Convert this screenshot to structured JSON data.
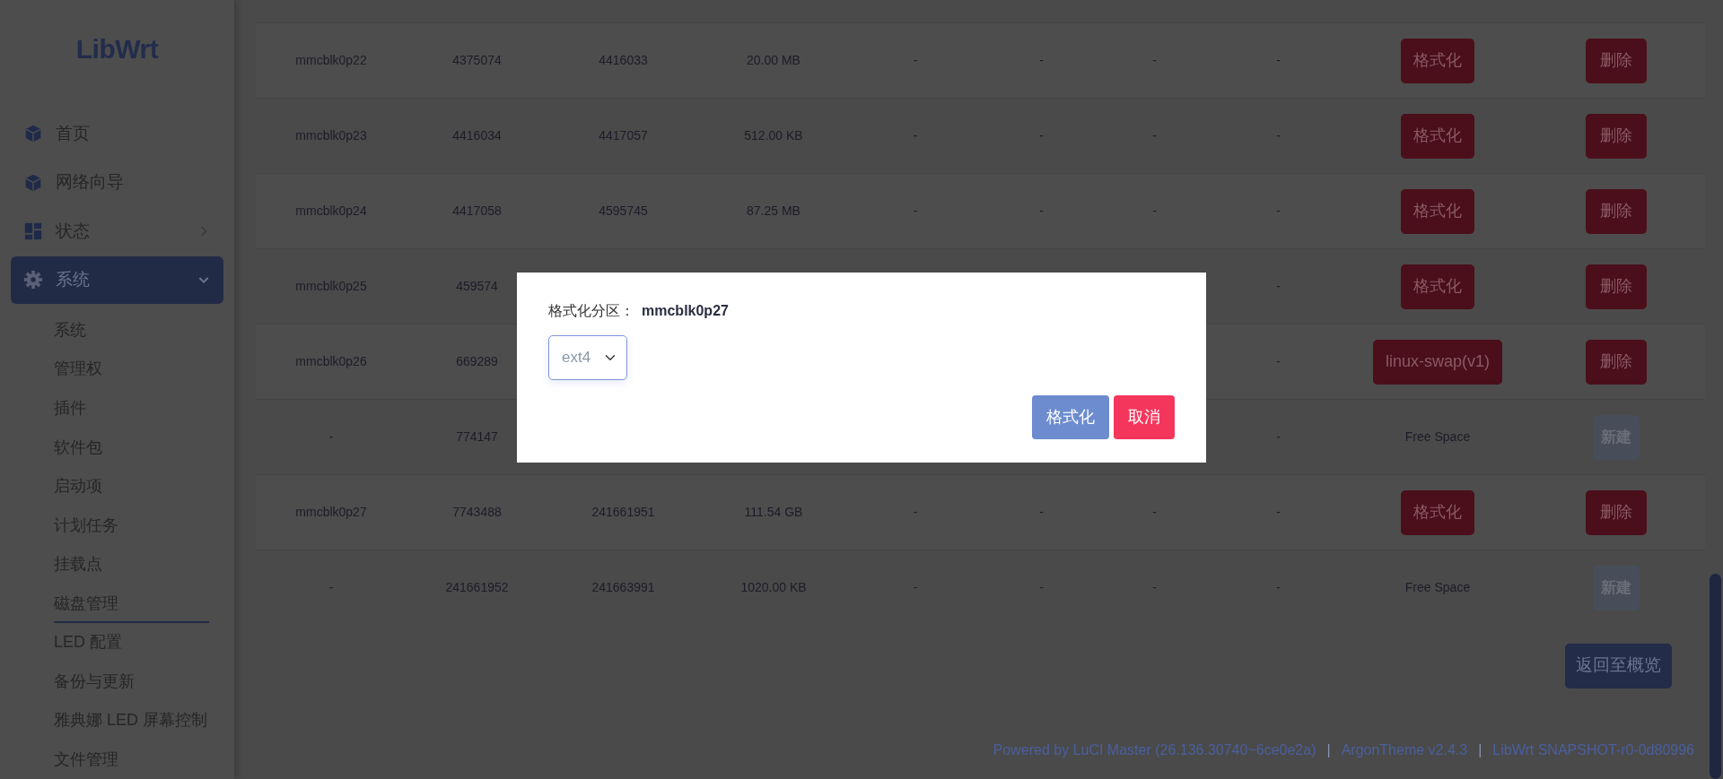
{
  "sidebar": {
    "logo": "LibWrt",
    "items": [
      {
        "label": "首页",
        "selected": false
      },
      {
        "label": "网络向导",
        "selected": false
      },
      {
        "label": "状态",
        "selected": false,
        "expanded": false
      },
      {
        "label": "系统",
        "selected": true,
        "expanded": true,
        "children": [
          {
            "label": "系统",
            "selected": false
          },
          {
            "label": "管理权",
            "selected": false
          },
          {
            "label": "插件",
            "selected": false
          },
          {
            "label": "软件包",
            "selected": false
          },
          {
            "label": "启动项",
            "selected": false
          },
          {
            "label": "计划任务",
            "selected": false
          },
          {
            "label": "挂载点",
            "selected": false
          },
          {
            "label": "磁盘管理",
            "selected": true
          },
          {
            "label": "LED 配置",
            "selected": false
          },
          {
            "label": "备份与更新",
            "selected": false
          },
          {
            "label": "雅典娜 LED 屏幕控制",
            "selected": false
          },
          {
            "label": "文件管理",
            "selected": false
          }
        ]
      }
    ]
  },
  "table": {
    "rows": [
      {
        "name": "mmcblk0p22",
        "start": "4375074",
        "end": "4416033",
        "size": "20.00 MB",
        "column_5": "-",
        "column_6": "-",
        "column_7": "-",
        "column_8": "-",
        "format": {
          "kind": "button",
          "label": "格式化"
        },
        "action": {
          "label": "删除",
          "disabled": false
        }
      },
      {
        "name": "mmcblk0p23",
        "start": "4416034",
        "end": "4417057",
        "size": "512.00 KB",
        "column_5": "-",
        "column_6": "-",
        "column_7": "-",
        "column_8": "-",
        "format": {
          "kind": "button",
          "label": "格式化"
        },
        "action": {
          "label": "删除",
          "disabled": false
        }
      },
      {
        "name": "mmcblk0p24",
        "start": "4417058",
        "end": "4595745",
        "size": "87.25 MB",
        "column_5": "-",
        "column_6": "-",
        "column_7": "-",
        "column_8": "-",
        "format": {
          "kind": "button",
          "label": "格式化"
        },
        "action": {
          "label": "删除",
          "disabled": false
        }
      },
      {
        "name": "mmcblk0p25",
        "start": "459574",
        "column_8": "-",
        "format": {
          "kind": "button",
          "label": "格式化"
        },
        "action": {
          "label": "删除",
          "disabled": false
        }
      },
      {
        "name": "mmcblk0p26",
        "start": "669289",
        "column_8": "-",
        "format": {
          "kind": "button",
          "label": "linux-swap(v1)"
        },
        "action": {
          "label": "删除",
          "disabled": false
        }
      },
      {
        "name": "-",
        "start": "774147",
        "column_8": "-",
        "format": {
          "kind": "text",
          "label": "Free Space"
        },
        "action": {
          "label": "新建",
          "disabled": true
        }
      },
      {
        "name": "mmcblk0p27",
        "start": "7743488",
        "end": "241661951",
        "size": "111.54 GB",
        "column_5": "-",
        "column_6": "-",
        "column_7": "-",
        "column_8": "-",
        "format": {
          "kind": "button",
          "label": "格式化"
        },
        "action": {
          "label": "删除",
          "disabled": false
        }
      },
      {
        "name": "-",
        "start": "241661952",
        "end": "241663991",
        "size": "1020.00 KB",
        "column_5": "-",
        "column_6": "-",
        "column_7": "-",
        "column_8": "-",
        "format": {
          "kind": "text",
          "label": "Free Space"
        },
        "action": {
          "label": "新建",
          "disabled": true
        }
      }
    ]
  },
  "back_button": "返回至概览",
  "footer": [
    {
      "kind": "link",
      "text": "Powered by LuCI Master (26.136.30740~6ce0e2a)"
    },
    {
      "kind": "separator",
      "text": "|"
    },
    {
      "kind": "link",
      "text": "ArgonTheme v2.4.3"
    },
    {
      "kind": "separator",
      "text": "|"
    },
    {
      "kind": "link",
      "text": "LibWrt SNAPSHOT-r0-0d80996"
    }
  ],
  "modal": {
    "label": "格式化分区：",
    "partition": "mmcblk0p27",
    "filesystem": "ext4",
    "buttons": [
      {
        "kind": "primary",
        "label": "格式化"
      },
      {
        "kind": "cancel",
        "label": "取消"
      }
    ]
  }
}
